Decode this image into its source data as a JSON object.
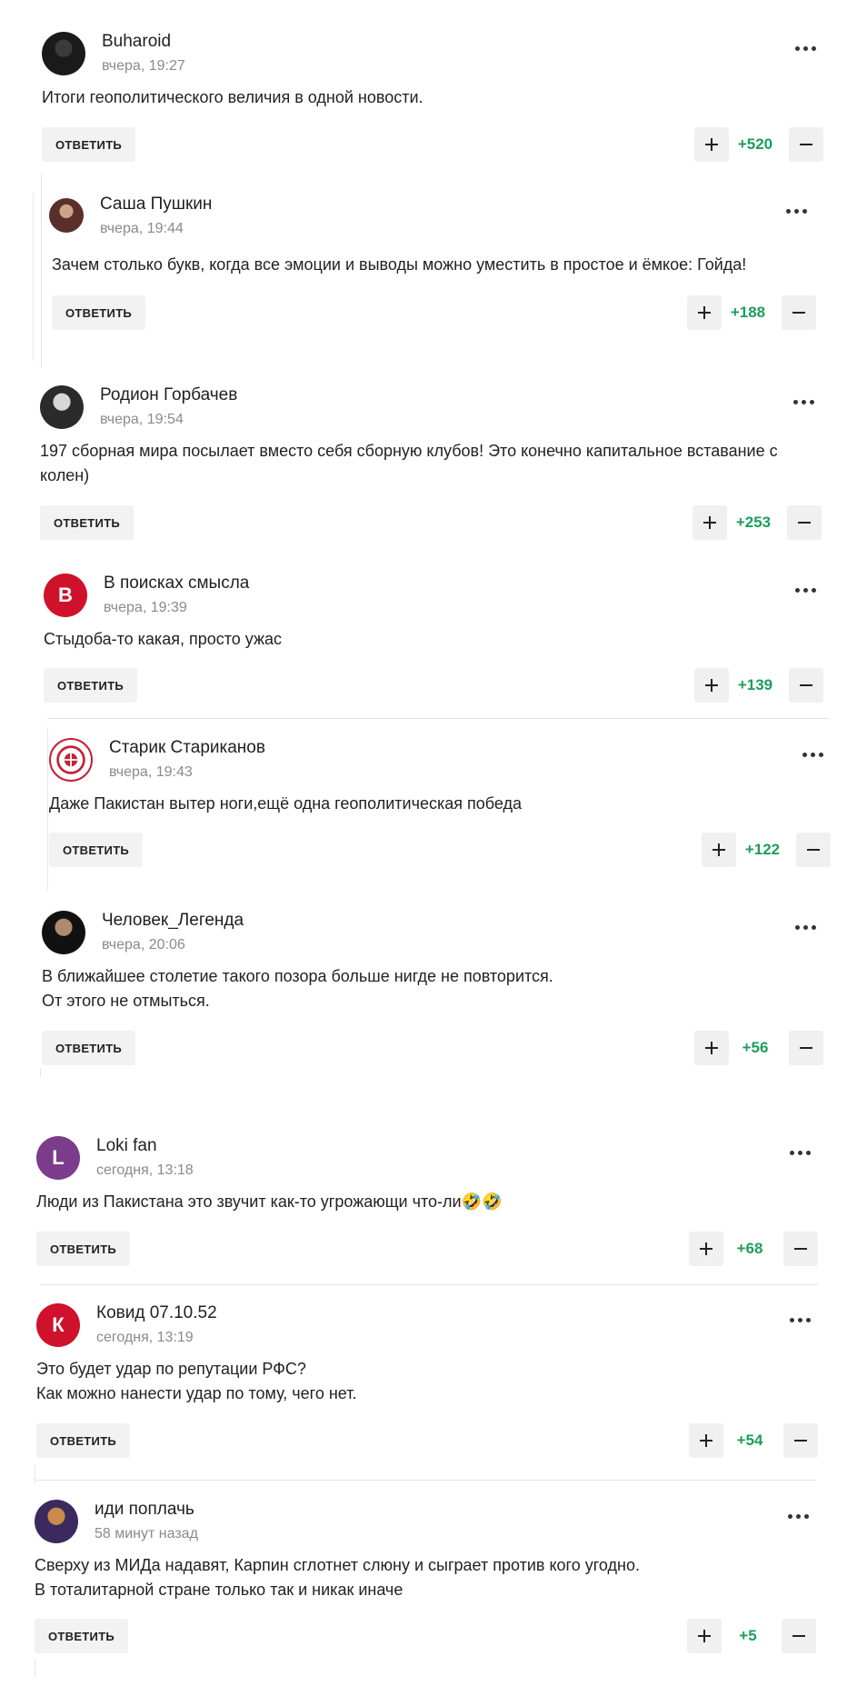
{
  "colors": {
    "score": "#1d9e5a",
    "button_bg": "#f2f2f2",
    "text": "#222222",
    "muted": "#8a8a8a"
  },
  "reply_label": "ОТВЕТИТЬ",
  "comments": [
    {
      "author": "Buharoid",
      "time": "вчера, 19:27",
      "text": [
        "Итоги геополитического величия в одной новости."
      ],
      "score": "+520",
      "avatar": {
        "type": "photo",
        "colors": [
          "#1a1a1a",
          "#3a3a3a"
        ]
      }
    },
    {
      "author": "Саша Пушкин",
      "time": "вчера, 19:44",
      "text": [
        "Зачем столько букв, когда все эмоции и выводы можно уместить в простое и ёмкое: Гойда!"
      ],
      "score": "+188",
      "avatar": {
        "type": "photo",
        "colors": [
          "#5a2f2a",
          "#c9a489"
        ]
      }
    },
    {
      "author": "Родион Горбачев",
      "time": "вчера, 19:54",
      "text": [
        "197 сборная мира посылает вместо себя сборную клубов! Это конечно капитальное вставание с",
        "колен)"
      ],
      "score": "+253",
      "avatar": {
        "type": "photo",
        "colors": [
          "#2b2b2b",
          "#d8d8d8"
        ]
      }
    },
    {
      "author": "В поисках смысла",
      "time": "вчера, 19:39",
      "text": [
        "Стыдоба-то какая, просто ужас"
      ],
      "score": "+139",
      "avatar": {
        "type": "letter",
        "letter": "В",
        "color": "#d0112b"
      }
    },
    {
      "author": "Старик Стариканов",
      "time": "вчера, 19:43",
      "text": [
        "Даже Пакистан вытер ноги,ещё одна геополитическая победа"
      ],
      "score": "+122",
      "avatar": {
        "type": "emblem",
        "colors": [
          "#c2223a",
          "#ffffff"
        ]
      }
    },
    {
      "author": "Человек_Легенда",
      "time": "вчера, 20:06",
      "text": [
        "В ближайшее столетие такого позора больше нигде не повторится.",
        "От этого не отмыться."
      ],
      "score": "+56",
      "avatar": {
        "type": "photo",
        "colors": [
          "#111111",
          "#b08a6e"
        ]
      }
    },
    {
      "author": "Loki fan",
      "time": "сегодня, 13:18",
      "text": [
        "Люди из Пакистана это звучит как-то угрожающи что-ли🤣🤣"
      ],
      "score": "+68",
      "avatar": {
        "type": "letter",
        "letter": "L",
        "color": "#7b3c8c"
      }
    },
    {
      "author": "Ковид 07.10.52",
      "time": "сегодня, 13:19",
      "text": [
        "Это будет удар по репутации РФС?",
        "Как можно нанести удар по тому, чего нет."
      ],
      "score": "+54",
      "avatar": {
        "type": "letter",
        "letter": "К",
        "color": "#d0112b"
      }
    },
    {
      "author": "иди поплачь",
      "time": "58 минут назад",
      "text": [
        "Сверху из МИДа надавят, Карпин сглотнет слюну и сыграет против кого угодно.",
        "В тоталитарной стране только так и никак иначе"
      ],
      "score": "+5",
      "avatar": {
        "type": "photo",
        "colors": [
          "#3a2a5e",
          "#c98a4a"
        ]
      }
    }
  ]
}
